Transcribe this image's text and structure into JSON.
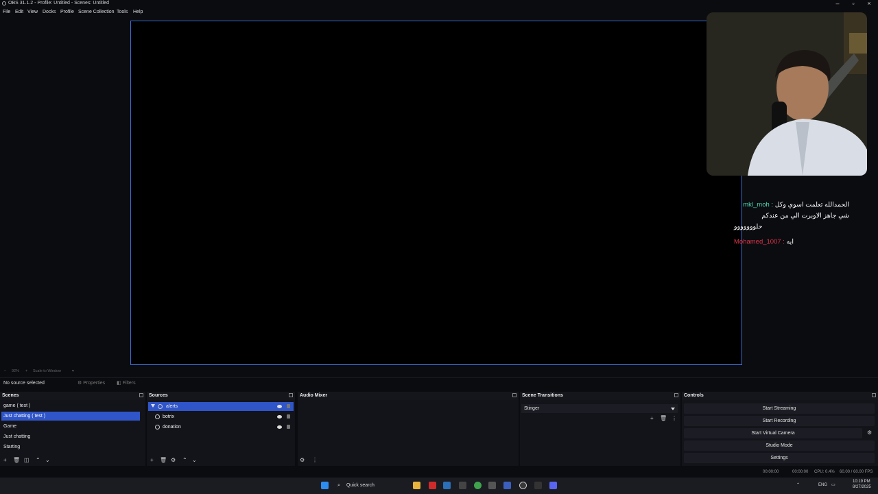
{
  "window": {
    "title": "OBS 31.1.2 - Profile: Untitled - Scenes: Untitled"
  },
  "menu": [
    "File",
    "Edit",
    "View",
    "Docks",
    "Profile",
    "Scene Collection",
    "Tools",
    "Help"
  ],
  "chat": [
    {
      "user": "mkl_moh :",
      "text": "الحمدالله تعلمت اسوي وكل",
      "line2": "شي جاهز الاوبرت الي من عندكم",
      "line3": "حلووووووو"
    },
    {
      "user": "Mohamed_1007 :",
      "text": "ايه"
    }
  ],
  "zoom": {
    "percent": "92%",
    "scale_label": "Scale to Window"
  },
  "properties_bar": {
    "no_source": "No source selected",
    "properties": "Properties",
    "filters": "Filters"
  },
  "scenes": {
    "title": "Scenes",
    "items": [
      "game ( test )",
      "Just chatting ( test )",
      "Game",
      "Just chatting",
      "Starting"
    ],
    "selected_index": 1
  },
  "sources": {
    "title": "Sources",
    "items": [
      "alerts",
      "botrix",
      "donation"
    ],
    "selected_index": 0
  },
  "audio_mixer": {
    "title": "Audio Mixer"
  },
  "scene_transitions": {
    "title": "Scene Transitions",
    "selected": "Stinger"
  },
  "controls": {
    "title": "Controls",
    "buttons": [
      "Start Streaming",
      "Start Recording",
      "Start Virtual Camera",
      "Studio Mode",
      "Settings"
    ]
  },
  "status": {
    "rec_time": "00:00:00",
    "stream_time": "00:00:00",
    "cpu": "CPU: 0.4%",
    "fps": "60.00 / 60.00 FPS"
  },
  "taskbar": {
    "search": "Quick search",
    "lang": "ENG",
    "time": "10:19 PM",
    "date": "8/27/2025"
  }
}
